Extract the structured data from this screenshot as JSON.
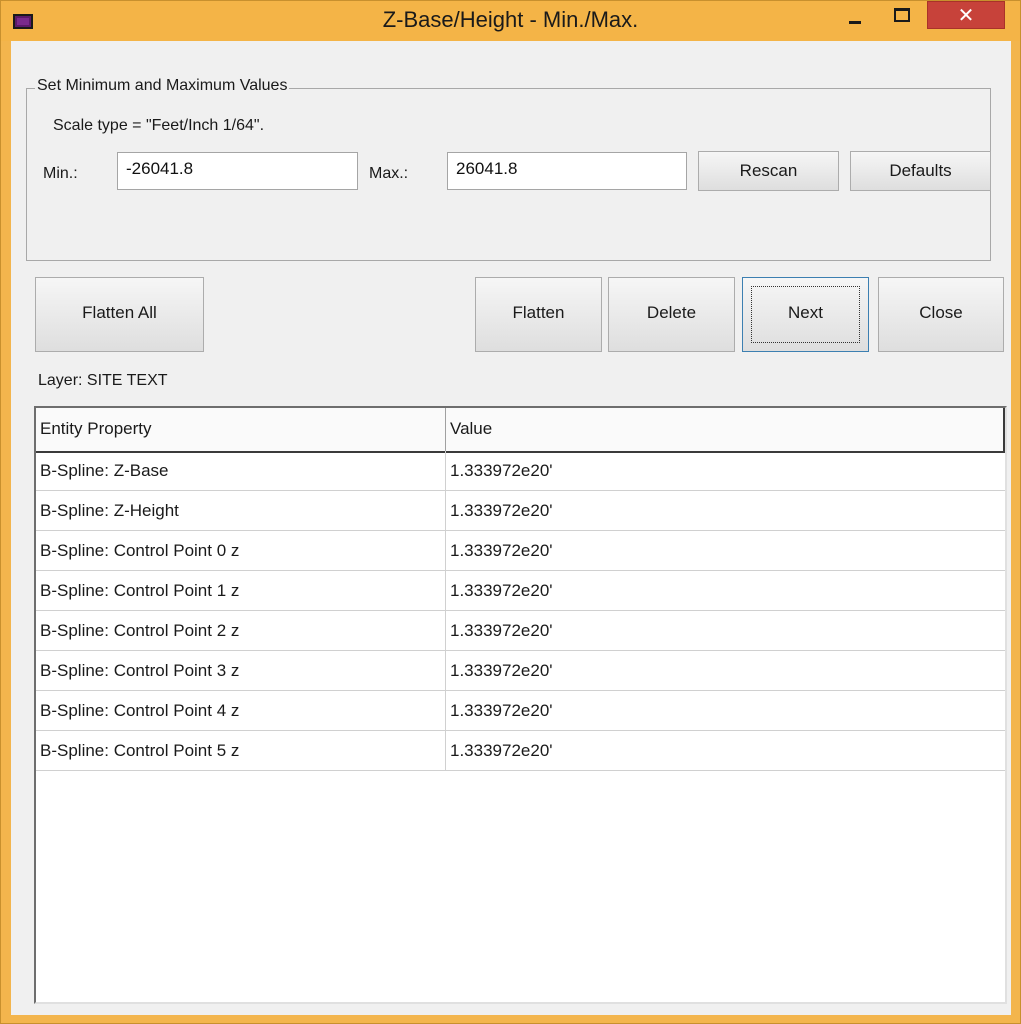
{
  "window": {
    "title": "Z-Base/Height - Min./Max.",
    "close_glyph": "✕"
  },
  "settings": {
    "group_title": "Set Minimum and Maximum Values",
    "scale_text": "Scale type = \"Feet/Inch 1/64\".",
    "min_label": "Min.:",
    "min_value": "-26041.8",
    "max_label": "Max.:",
    "max_value": "26041.8",
    "rescan_label": "Rescan",
    "defaults_label": "Defaults"
  },
  "actions": {
    "flatten_all_label": "Flatten All",
    "flatten_label": "Flatten",
    "delete_label": "Delete",
    "next_label": "Next",
    "close_label": "Close"
  },
  "layer_text": "Layer: SITE TEXT",
  "table": {
    "columns": [
      "Entity Property",
      "Value"
    ],
    "rows": [
      {
        "property": "B-Spline: Z-Base",
        "value": "1.333972e20'"
      },
      {
        "property": "B-Spline: Z-Height",
        "value": "1.333972e20'"
      },
      {
        "property": "B-Spline: Control Point 0 z",
        "value": "1.333972e20'"
      },
      {
        "property": "B-Spline: Control Point 1 z",
        "value": "1.333972e20'"
      },
      {
        "property": "B-Spline: Control Point 2 z",
        "value": "1.333972e20'"
      },
      {
        "property": "B-Spline: Control Point 3 z",
        "value": "1.333972e20'"
      },
      {
        "property": "B-Spline: Control Point 4 z",
        "value": "1.333972e20'"
      },
      {
        "property": "B-Spline: Control Point 5 z",
        "value": "1.333972e20'"
      }
    ]
  },
  "colors": {
    "titlebar": "#f4b447",
    "close_button": "#c7423a",
    "dialog_background": "#f0f0f0"
  }
}
